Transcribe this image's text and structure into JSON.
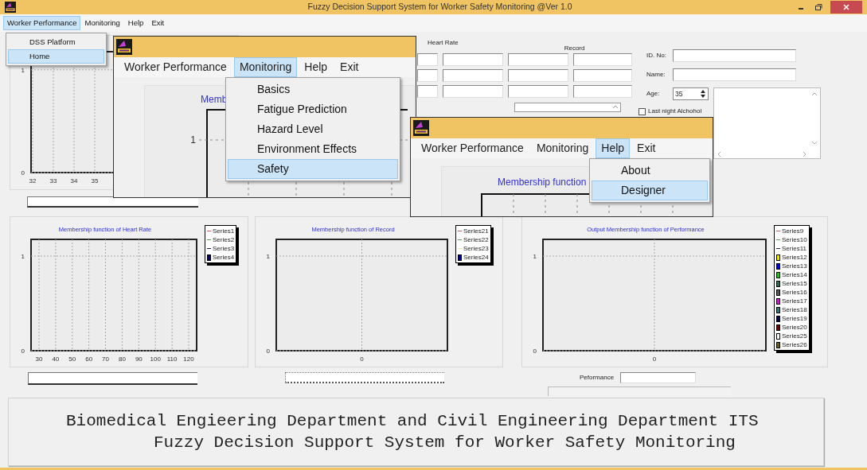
{
  "window": {
    "title": "Fuzzy Decision Support System for Worker Safety Monitoring  @Ver 1.0"
  },
  "menu": [
    {
      "label": "Worker Performance",
      "selected": true
    },
    {
      "label": "Monitoring",
      "selected": false
    },
    {
      "label": "Help",
      "selected": false
    },
    {
      "label": "Exit",
      "selected": false
    }
  ],
  "menu_dropdown": [
    {
      "label": "DSS Platform",
      "selected": false
    },
    {
      "label": "Home",
      "selected": true
    }
  ],
  "top_chart": {
    "y_ticks": [
      "1",
      "0"
    ],
    "x_ticks": [
      "32",
      "33",
      "34",
      "35"
    ]
  },
  "readings": {
    "heart_rate_label": "Heart Rate",
    "record_label": "Record"
  },
  "patient": {
    "id_label": "ID. No:",
    "name_label": "Name:",
    "age_label": "Age:",
    "age_value": "35",
    "alcohol": {
      "label": "Last night Alchohol",
      "checked": false
    }
  },
  "charts": [
    {
      "title": "Membership function of Heart Rate",
      "y_ticks": [
        "1",
        "0"
      ],
      "x_ticks": [
        "30",
        "40",
        "50",
        "60",
        "70",
        "80",
        "90",
        "100",
        "110",
        "120"
      ],
      "legend": [
        {
          "label": "Series1",
          "kind": "line",
          "color": "#d06060"
        },
        {
          "label": "Series2",
          "kind": "line",
          "color": "#60a060"
        },
        {
          "label": "Series3",
          "kind": "line",
          "color": "#202040"
        },
        {
          "label": "Series4",
          "kind": "box",
          "color": "#000080"
        }
      ]
    },
    {
      "title": "Membership function of Record",
      "y_ticks": [
        "1",
        "0"
      ],
      "x_ticks": [
        "0"
      ],
      "legend": [
        {
          "label": "Series21",
          "kind": "line",
          "color": "#d06060"
        },
        {
          "label": "Series22",
          "kind": "line",
          "color": "#60a060"
        },
        {
          "label": "Series23",
          "kind": "line",
          "color": "#f0e8a0"
        },
        {
          "label": "Series24",
          "kind": "box",
          "color": "#000080"
        }
      ]
    },
    {
      "title": "Output Membership function of Performance",
      "y_ticks": [
        "1",
        "0"
      ],
      "x_ticks": [
        "0"
      ],
      "legend": [
        {
          "label": "Series9",
          "kind": "line",
          "color": "#d06060"
        },
        {
          "label": "Series10",
          "kind": "line",
          "color": "#60a060"
        },
        {
          "label": "Series11",
          "kind": "line",
          "color": "#202060"
        },
        {
          "label": "Series12",
          "kind": "box",
          "color": "#e8e800"
        },
        {
          "label": "Series13",
          "kind": "box",
          "color": "#0000c0"
        },
        {
          "label": "Series14",
          "kind": "box",
          "color": "#20c020"
        },
        {
          "label": "Series15",
          "kind": "box",
          "color": "#306850"
        },
        {
          "label": "Series16",
          "kind": "box",
          "color": "#585858"
        },
        {
          "label": "Series17",
          "kind": "box",
          "color": "#c020c0"
        },
        {
          "label": "Series18",
          "kind": "box",
          "color": "#307878"
        },
        {
          "label": "Series19",
          "kind": "box",
          "color": "#000040"
        },
        {
          "label": "Series20",
          "kind": "box",
          "color": "#600000"
        },
        {
          "label": "Series25",
          "kind": "box",
          "color": "#ffffff"
        },
        {
          "label": "Series26",
          "kind": "box",
          "color": "#686020"
        }
      ]
    }
  ],
  "performance": {
    "label": "Peformance"
  },
  "footer": [
    "Biomedical Engieering Department and Civil Engineering Department ITS",
    "Fuzzy Decision Support System for Worker Safety Monitoring"
  ],
  "child_windows": [
    {
      "menu": [
        {
          "label": "Worker Performance",
          "selected": false
        },
        {
          "label": "Monitoring",
          "selected": true
        },
        {
          "label": "Help",
          "selected": false
        },
        {
          "label": "Exit",
          "selected": false
        }
      ],
      "dropdown": [
        {
          "label": "Basics",
          "selected": false
        },
        {
          "label": "Fatigue Prediction",
          "selected": false
        },
        {
          "label": "Hazard Level",
          "selected": false
        },
        {
          "label": "Environment Effects",
          "selected": false
        },
        {
          "label": "Safety",
          "selected": true
        }
      ],
      "chart_title": "Memb",
      "y_ticks": [
        "1"
      ]
    },
    {
      "menu": [
        {
          "label": "Worker Performance",
          "selected": false
        },
        {
          "label": "Monitoring",
          "selected": false
        },
        {
          "label": "Help",
          "selected": true
        },
        {
          "label": "Exit",
          "selected": false
        }
      ],
      "dropdown": [
        {
          "label": "About",
          "selected": false
        },
        {
          "label": "Designer",
          "selected": true
        }
      ],
      "chart_title": "Membership function"
    }
  ]
}
